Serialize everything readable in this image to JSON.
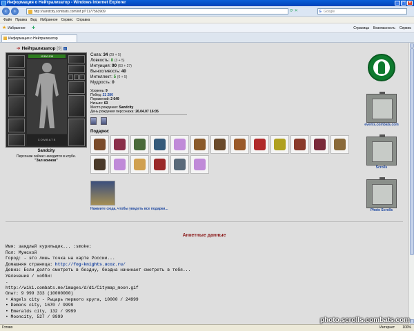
{
  "window": {
    "title": "Информация о Нейтрализатор - Windows Internet Explorer"
  },
  "address": {
    "url": "http://sandcity.combats.com/inf.pl?1177563909",
    "search_placeholder": "Google"
  },
  "menu": [
    "Файл",
    "Правка",
    "Вид",
    "Избранное",
    "Сервис",
    "Справка"
  ],
  "favorites": {
    "label": "Избранное",
    "tools": [
      "Страница",
      "Безопасность",
      "Сервис"
    ]
  },
  "tab": {
    "label": "Информация о Нейтрализатор"
  },
  "character": {
    "name": "Нейтрализатор",
    "level_badge": "[9]",
    "hp": "1135/1135",
    "city": "Sandcity",
    "club_line1": "Персонаж сейчас находится в клубе.",
    "club_line2": "\"Зал воинов\""
  },
  "stats": [
    {
      "label": "Сила:",
      "value": "34",
      "extra": "(29 + 5)",
      "color": "#000000"
    },
    {
      "label": "Ловкость:",
      "value": "8",
      "extra": "(3 + 5)",
      "color": "#2a8a2a"
    },
    {
      "label": "Интуиция:",
      "value": "90",
      "extra": "(63 + 27)",
      "color": "#000000"
    },
    {
      "label": "Выносливость:",
      "value": "40",
      "extra": "",
      "color": "#000000"
    },
    {
      "label": "Интеллект:",
      "value": "5",
      "extra": "(0 + 5)",
      "color": "#2a8a2a"
    },
    {
      "label": "Мудрость:",
      "value": "0",
      "extra": "",
      "color": "#000000"
    }
  ],
  "info": [
    {
      "label": "Уровень:",
      "value": "9"
    },
    {
      "label": "Побед:",
      "value": "21 280"
    },
    {
      "label": "Поражений:",
      "value": "2 649"
    },
    {
      "label": "Ничьих:",
      "value": "63"
    },
    {
      "label": "Место рождения:",
      "value": "Sandcity"
    },
    {
      "label": "День рождения персонажа:",
      "value": "26.04.07 16:05"
    }
  ],
  "gifts": {
    "title": "Подарки:",
    "row1_colors": [
      "#7a4b2a",
      "#8a2f4a",
      "#4a6a3a",
      "#355a7a",
      "#c08ad8",
      "#8a5a2a",
      "#6a4a2a",
      "#9a5a2a",
      "#b02a2a",
      "#b0a020",
      "#8a3a2a",
      "#7a2a3a",
      "#8a6a3a"
    ],
    "row2_colors": [
      "#4a3a2a",
      "#c08ad8",
      "#d0a050",
      "#9a2a2a",
      "#5a6a7a",
      "#c08ad8"
    ],
    "more_link": "Нажмите сюда, чтобы увидеть все подарки..."
  },
  "sidebar": {
    "links": [
      "events.combats.com",
      "Scrolls",
      "Photo Scrolls"
    ]
  },
  "anket": {
    "title": "Анкетные данные",
    "lines": [
      "Имя: заядлый курильщик... :smoke:",
      "Пол: Мужской",
      "Город: - это лишь точка на карте России...",
      "Домашняя страница: ",
      "Девиз: Если долго смотреть в бездну, бездна начинает смотреть в тебя...",
      "Увлечения / хобби:",
      ".",
      "http://wiki.combats.me/images/d/d1/Citymap_moon.gif",
      "",
      "Опыт: 9 999 333 (10000000)",
      "",
      "• Angels city - Рыцарь первого круга, 10000 / 24999",
      "• Demons city, 1670 / 9999",
      "• Emeralds city, 132 / 9999",
      "• Mooncity, 527 / 9999"
    ],
    "homepage": "http://fog-knights.ucoz.ru/"
  },
  "status": {
    "left": "Готово",
    "zone": "Интернет",
    "zoom": "100%"
  },
  "watermark": "photo.scrolls.combats.com"
}
